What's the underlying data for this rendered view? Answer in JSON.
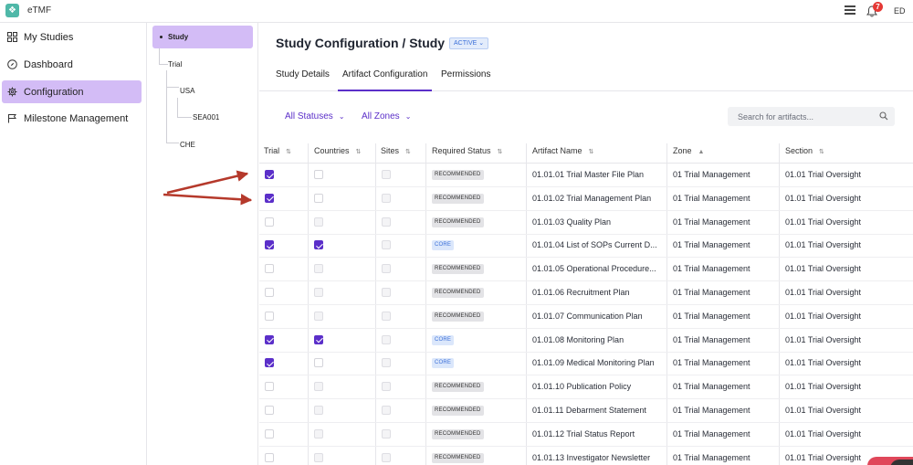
{
  "app": {
    "name": "eTMF",
    "logo_glyph": "❖",
    "notification_count": "7",
    "user_initials": "ED"
  },
  "sidebar": {
    "items": [
      {
        "label": "My Studies",
        "icon": "grid-icon",
        "active": false
      },
      {
        "label": "Dashboard",
        "icon": "compass-icon",
        "active": false
      },
      {
        "label": "Configuration",
        "icon": "gear-icon",
        "active": true
      },
      {
        "label": "Milestone Management",
        "icon": "flag-icon",
        "active": false
      }
    ]
  },
  "tree": {
    "nodes": [
      {
        "label": "Study",
        "level": 0,
        "selected": true
      },
      {
        "label": "Trial",
        "level": 1
      },
      {
        "label": "USA",
        "level": 2
      },
      {
        "label": "SEA001",
        "level": 3
      },
      {
        "label": "CHE",
        "level": 2
      }
    ]
  },
  "main": {
    "title": "Study Configuration / Study",
    "status": "ACTIVE",
    "tabs": [
      {
        "label": "Study Details",
        "active": false
      },
      {
        "label": "Artifact Configuration",
        "active": true
      },
      {
        "label": "Permissions",
        "active": false
      }
    ],
    "filters": {
      "status": "All Statuses",
      "zone": "All Zones"
    },
    "search": {
      "placeholder": "Search for artifacts..."
    }
  },
  "table": {
    "columns": [
      "Trial",
      "Countries",
      "Sites",
      "Required Status",
      "Artifact Name",
      "Zone",
      "Section"
    ],
    "rows": [
      {
        "trial": true,
        "countries": false,
        "sites": false,
        "status": "RECOMMENDED",
        "name": "01.01.01 Trial Master File Plan",
        "zone": "01 Trial Management",
        "section": "01.01 Trial Oversight"
      },
      {
        "trial": true,
        "countries": false,
        "sites": false,
        "status": "RECOMMENDED",
        "name": "01.01.02 Trial Management Plan",
        "zone": "01 Trial Management",
        "section": "01.01 Trial Oversight"
      },
      {
        "trial": false,
        "countries": false,
        "sites": false,
        "status": "RECOMMENDED",
        "name": "01.01.03 Quality Plan",
        "zone": "01 Trial Management",
        "section": "01.01 Trial Oversight"
      },
      {
        "trial": true,
        "countries": true,
        "sites": false,
        "status": "CORE",
        "name": "01.01.04 List of SOPs Current D...",
        "zone": "01 Trial Management",
        "section": "01.01 Trial Oversight"
      },
      {
        "trial": false,
        "countries": false,
        "sites": false,
        "status": "RECOMMENDED",
        "name": "01.01.05 Operational Procedure...",
        "zone": "01 Trial Management",
        "section": "01.01 Trial Oversight"
      },
      {
        "trial": false,
        "countries": false,
        "sites": false,
        "status": "RECOMMENDED",
        "name": "01.01.06 Recruitment Plan",
        "zone": "01 Trial Management",
        "section": "01.01 Trial Oversight"
      },
      {
        "trial": false,
        "countries": false,
        "sites": false,
        "status": "RECOMMENDED",
        "name": "01.01.07 Communication Plan",
        "zone": "01 Trial Management",
        "section": "01.01 Trial Oversight"
      },
      {
        "trial": true,
        "countries": true,
        "sites": false,
        "status": "CORE",
        "name": "01.01.08 Monitoring Plan",
        "zone": "01 Trial Management",
        "section": "01.01 Trial Oversight"
      },
      {
        "trial": true,
        "countries": false,
        "sites": false,
        "status": "CORE",
        "name": "01.01.09 Medical Monitoring Plan",
        "zone": "01 Trial Management",
        "section": "01.01 Trial Oversight"
      },
      {
        "trial": false,
        "countries": false,
        "sites": false,
        "status": "RECOMMENDED",
        "name": "01.01.10 Publication Policy",
        "zone": "01 Trial Management",
        "section": "01.01 Trial Oversight"
      },
      {
        "trial": false,
        "countries": false,
        "sites": false,
        "status": "RECOMMENDED",
        "name": "01.01.11 Debarment Statement",
        "zone": "01 Trial Management",
        "section": "01.01 Trial Oversight"
      },
      {
        "trial": false,
        "countries": false,
        "sites": false,
        "status": "RECOMMENDED",
        "name": "01.01.12 Trial Status Report",
        "zone": "01 Trial Management",
        "section": "01.01 Trial Oversight"
      },
      {
        "trial": false,
        "countries": false,
        "sites": false,
        "status": "RECOMMENDED",
        "name": "01.01.13 Investigator Newsletter",
        "zone": "01 Trial Management",
        "section": "01.01 Trial Oversight"
      }
    ]
  },
  "colors": {
    "accent": "#5b2fc9",
    "active_bg": "#d3bcf6",
    "arrow": "#b5392b"
  }
}
